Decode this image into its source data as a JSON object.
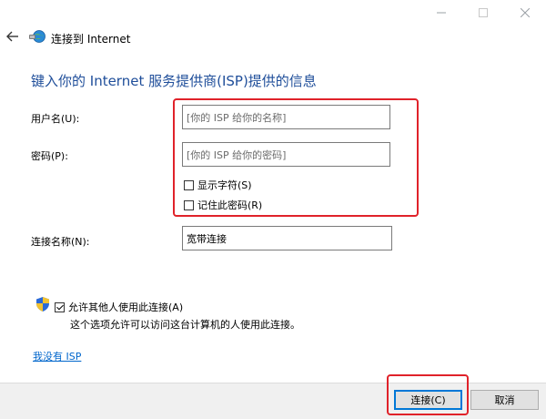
{
  "window": {
    "title": "连接到 Internet",
    "controls": {
      "minimize_icon": "minimize-icon",
      "maximize_icon": "maximize-icon",
      "close_icon": "close-icon"
    }
  },
  "nav": {
    "back_icon": "back-arrow-icon",
    "app_icon": "network-globe-icon"
  },
  "heading": "键入你的 Internet 服务提供商(ISP)提供的信息",
  "fields": {
    "username": {
      "label": "用户名(U):",
      "placeholder": "[你的 ISP 给你的名称]"
    },
    "password": {
      "label": "密码(P):",
      "placeholder": "[你的 ISP 给你的密码]"
    },
    "show_chars": {
      "label": "显示字符(S)",
      "checked": false
    },
    "remember_password": {
      "label": "记住此密码(R)",
      "checked": false
    },
    "connection_name": {
      "label": "连接名称(N):",
      "value": "宽带连接"
    }
  },
  "allow_others": {
    "label": "允许其他人使用此连接(A)",
    "checked": true,
    "note": "这个选项允许可以访问这台计算机的人使用此连接。",
    "icon": "uac-shield-icon"
  },
  "link": {
    "no_isp": "我没有 ISP"
  },
  "buttons": {
    "connect": "连接(C)",
    "cancel": "取消"
  },
  "colors": {
    "heading": "#1f4e9a",
    "link": "#0066cc",
    "highlight": "#e0222a",
    "focus_border": "#0078d7"
  }
}
